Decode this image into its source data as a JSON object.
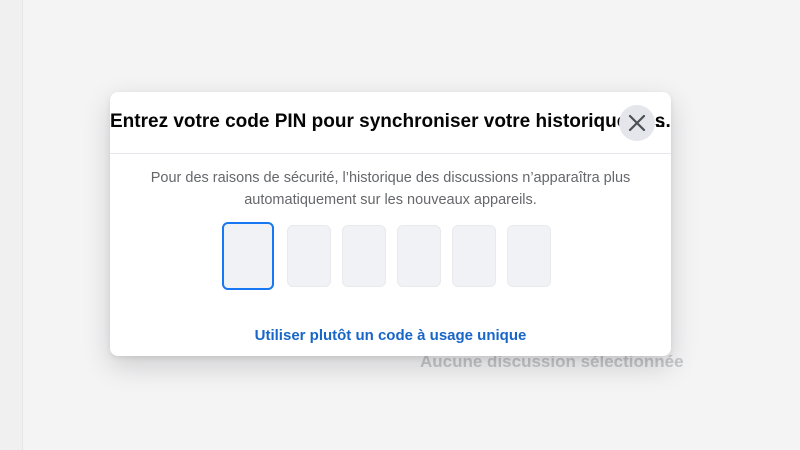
{
  "background": {
    "empty_state": "Aucune discussion sélectionnée"
  },
  "modal": {
    "title": "Entrez votre code PIN pour synchroniser votre historique des discussions",
    "title_ellipsis": "...",
    "close_icon": "close-icon",
    "description_line1": "Pour des raisons de sécurité, l’historique des discussions n’apparaîtra plus",
    "description_line2": "automatiquement sur les nouveaux appareils.",
    "pin_digits": [
      "",
      "",
      "",
      "",
      "",
      ""
    ],
    "alt_link": "Utiliser plutôt un code à usage unique"
  },
  "colors": {
    "accent": "#1877f2",
    "link": "#1866c8",
    "pin_fill": "#f0f2f5",
    "muted_text": "#65676b"
  }
}
